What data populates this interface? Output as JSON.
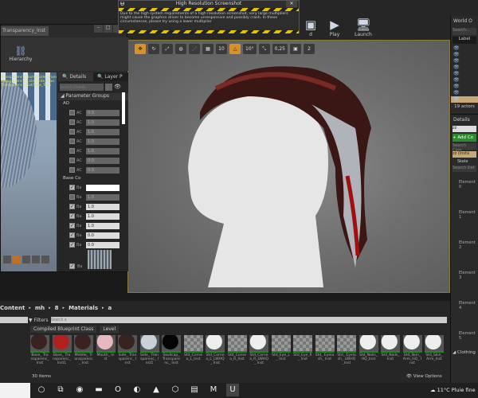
{
  "toolbar": {
    "build_label": "d",
    "play_label": "Play",
    "launch_label": "Launch"
  },
  "viewport": {
    "tools": [
      "✥",
      "↻",
      "⤢",
      "◍",
      "⋰",
      "▦",
      "10",
      "△",
      "10°",
      "⤡",
      "0,25",
      "▣",
      "2"
    ]
  },
  "dialog": {
    "title": "High Resolution Screenshot",
    "message": "Due to the high system requirements of a high resolution screenshot, very large multipliers might cause the graphics driver to become unresponsive and possibly crash. In these circumstances, please try using a lower multiplier",
    "close": "✕"
  },
  "material_window": {
    "tab": "Transparency_Inst",
    "hierarchy_label": "Hierarchy",
    "overlay_text": [
      "Transparency_Bump/Side_Trans",
      "Transparency_Color/Side_Tran",
      "Transparency_Sat/Side_Tran"
    ],
    "details_tab": "Details",
    "layer_tab": "Layer P",
    "search_placeholder": "Search Details",
    "parameter_groups": "Parameter Groups",
    "groups": [
      {
        "name": "AO",
        "rows": [
          {
            "label": "AC",
            "value": "0.0",
            "on": false
          },
          {
            "label": "AC",
            "value": "1.0",
            "on": false
          },
          {
            "label": "AC",
            "value": "1.0",
            "on": false
          },
          {
            "label": "AC",
            "value": "1.0",
            "on": false
          },
          {
            "label": "AC",
            "value": "1.0",
            "on": false
          },
          {
            "label": "AC",
            "value": "0.0",
            "on": false
          },
          {
            "label": "AC",
            "value": "0.0",
            "on": false
          }
        ]
      },
      {
        "name": "Base Co",
        "rows": [
          {
            "label": "Ba",
            "value": "",
            "on": true
          },
          {
            "label": "Ba",
            "value": "1.0",
            "on": false
          },
          {
            "label": "Ba",
            "value": "1.0",
            "on": true
          },
          {
            "label": "Ba",
            "value": "1.0",
            "on": true
          },
          {
            "label": "Ba",
            "value": "1.0",
            "on": true
          },
          {
            "label": "Ba",
            "value": "0.0",
            "on": true
          },
          {
            "label": "Ba",
            "value": "0.0",
            "on": true
          }
        ]
      }
    ],
    "texture_label": "Ba"
  },
  "outliner": {
    "title": "World O",
    "search": "Search...",
    "label_col": "Label",
    "count": "19 actors"
  },
  "right_details": {
    "title": "Details",
    "name_value": "zz",
    "add_button": "+ Add Co",
    "search_comp": "Search Com",
    "instance": "zz (Insta",
    "skeletal": "Skele",
    "search_details": "Search Det",
    "elements": [
      "Element 0",
      "Element 1",
      "Element 2",
      "Element 3",
      "Element 4",
      "Element 5"
    ],
    "clothing": "Clothing"
  },
  "content_browser": {
    "breadcrumb": [
      "Content",
      "mh",
      "8",
      "Materials",
      "a"
    ],
    "filters": "Filters",
    "search_placeholder": "Search a",
    "filter_chips": [
      "Compiled Blueprint Class",
      "Level"
    ],
    "item_count": "30 items",
    "view_options": "View Options",
    "assets": [
      {
        "name": "Base_ Transparenc_ Inst",
        "c": "#3a2220"
      },
      {
        "name": "Base_ Transparenc_ Inst1",
        "c": "#b02020"
      },
      {
        "name": "Middle_ Transparenc_ Inst",
        "c": "#3a2220"
      },
      {
        "name": "Mouth_ Inst",
        "c": "#e8b8c0"
      },
      {
        "name": "Side_ Transparenc_ Inst",
        "c": "#3a2220"
      },
      {
        "name": "Side_ Transparenc_ Inst1",
        "c": "#c8d0d8"
      },
      {
        "name": "Skullcap_ Transparenc_ Inst",
        "c": "#050505"
      },
      {
        "name": "Std_Cornea_L_Inst",
        "c": ""
      },
      {
        "name": "Std_Cornea_L_LWHQ_ Inst",
        "c": "#eeeeee"
      },
      {
        "name": "Std_Cornea_R_Inst",
        "c": ""
      },
      {
        "name": "Std_Cornea_R_LWHQ_ Inst",
        "c": "#eeeeee"
      },
      {
        "name": "Std_Eye_L_ Inst",
        "c": ""
      },
      {
        "name": "Std_Eye_R_ Inst",
        "c": ""
      },
      {
        "name": "Std_ Eyelash_ Inst",
        "c": ""
      },
      {
        "name": "Std_ Eyelash_ LWHQ_Inst",
        "c": ""
      },
      {
        "name": "Std_Nails_ HQ_Inst",
        "c": "#eeeeee"
      },
      {
        "name": "Std_Nails_ Inst",
        "c": "#eeeeee"
      },
      {
        "name": "Std_Skin_ Arm_HQ_ Inst",
        "c": "#eeeeee"
      },
      {
        "name": "Std_Skin_ Arm_Inst",
        "c": "#eeeeee"
      }
    ]
  },
  "taskbar": {
    "weather": "11°C  Pluie fine",
    "apps": [
      "○",
      "⧉",
      "◉",
      "▬",
      "O",
      "◐",
      "▲",
      "⬡",
      "▤",
      "M",
      "U"
    ]
  }
}
